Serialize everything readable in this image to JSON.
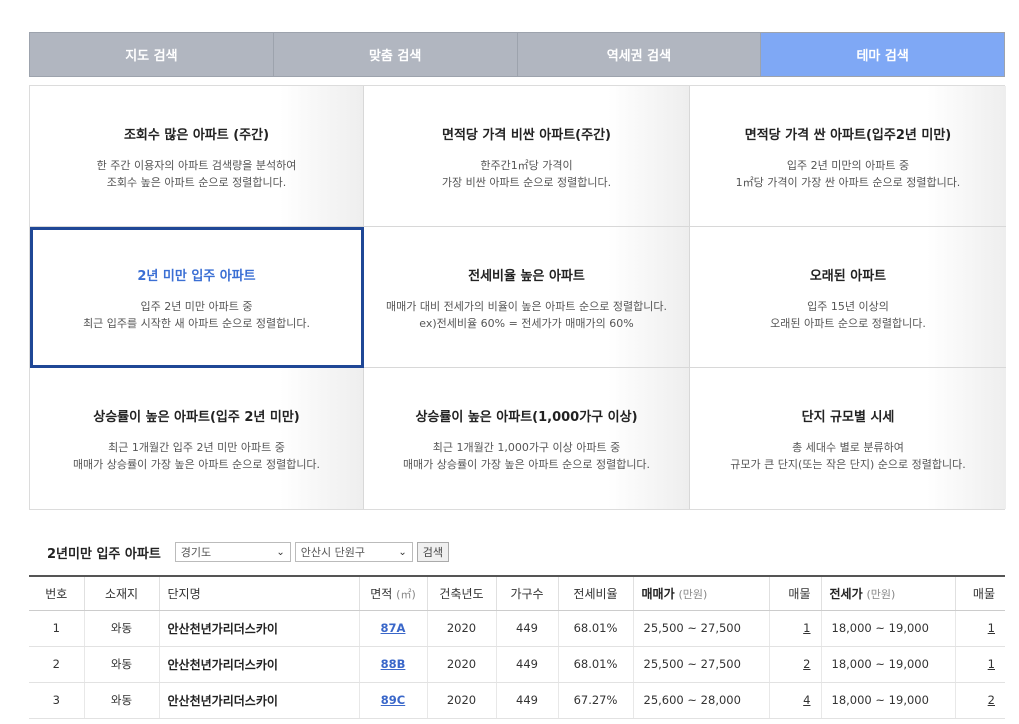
{
  "tabs": [
    {
      "label": "지도 검색"
    },
    {
      "label": "맞춤 검색"
    },
    {
      "label": "역세권 검색"
    },
    {
      "label": "테마 검색"
    }
  ],
  "themes": [
    {
      "title": "조회수 많은 아파트 (주간)",
      "desc1": "한 주간 이용자의 아파트 검색량을 분석하여",
      "desc2": "조회수 높은 아파트 순으로 정렬합니다."
    },
    {
      "title": "면적당 가격 비싼 아파트(주간)",
      "desc1": "한주간1㎡당 가격이",
      "desc2": "가장 비싼 아파트 순으로 정렬합니다."
    },
    {
      "title": "면적당 가격 싼 아파트(입주2년 미만)",
      "desc1": "입주 2년 미만의 아파트 중",
      "desc2": "1㎡당 가격이 가장 싼 아파트 순으로 정렬합니다."
    },
    {
      "title": "2년 미만 입주 아파트",
      "desc1": "입주 2년 미만 아파트 중",
      "desc2": "최근 입주를 시작한 새 아파트 순으로 정렬합니다."
    },
    {
      "title": "전세비율 높은 아파트",
      "desc1": "매매가 대비 전세가의 비율이 높은 아파트 순으로 정렬합니다.",
      "desc2": "ex)전세비율 60% = 전세가가 매매가의 60%"
    },
    {
      "title": "오래된 아파트",
      "desc1": "입주 15년 이상의",
      "desc2": "오래된 아파트 순으로 정렬합니다."
    },
    {
      "title": "상승률이 높은 아파트(입주 2년 미만)",
      "desc1": "최근 1개월간 입주 2년 미만 아파트 중",
      "desc2": "매매가 상승률이 가장 높은 아파트 순으로 정렬합니다."
    },
    {
      "title": "상승률이 높은 아파트(1,000가구 이상)",
      "desc1": "최근 1개월간 1,000가구 이상 아파트 중",
      "desc2": "매매가 상승률이 가장 높은 아파트 순으로 정렬합니다."
    },
    {
      "title": "단지 규모별 시세",
      "desc1": "총 세대수 별로 분류하여",
      "desc2": "규모가 큰 단지(또는 작은 단지) 순으로 정렬합니다."
    }
  ],
  "filter": {
    "label": "2년미만 입주 아파트",
    "province": "경기도",
    "district": "안산시 단원구",
    "search_btn": "검색"
  },
  "table": {
    "headers": {
      "no": "번호",
      "location": "소재지",
      "name": "단지명",
      "area": "면적",
      "area_unit": "(㎡)",
      "year": "건축년도",
      "households": "가구수",
      "ratio": "전세비율",
      "sale": "매매가",
      "sale_unit": "(만원)",
      "sale_cnt": "매물",
      "jeonse": "전세가",
      "jeonse_unit": "(만원)",
      "jeonse_cnt": "매물"
    },
    "rows": [
      {
        "no": "1",
        "location": "와동",
        "name": "안산천년가리더스카이",
        "area": "87A",
        "year": "2020",
        "households": "449",
        "ratio": "68.01%",
        "sale": "25,500 ~ 27,500",
        "sale_cnt": "1",
        "jeonse": "18,000 ~ 19,000",
        "jeonse_cnt": "1"
      },
      {
        "no": "2",
        "location": "와동",
        "name": "안산천년가리더스카이",
        "area": "88B",
        "year": "2020",
        "households": "449",
        "ratio": "68.01%",
        "sale": "25,500 ~ 27,500",
        "sale_cnt": "2",
        "jeonse": "18,000 ~ 19,000",
        "jeonse_cnt": "1"
      },
      {
        "no": "3",
        "location": "와동",
        "name": "안산천년가리더스카이",
        "area": "89C",
        "year": "2020",
        "households": "449",
        "ratio": "67.27%",
        "sale": "25,600 ~ 28,000",
        "sale_cnt": "4",
        "jeonse": "18,000 ~ 19,000",
        "jeonse_cnt": "2"
      }
    ]
  },
  "colors": {
    "active_tab": "#7fa8f5",
    "selected_border": "#1f4796",
    "selected_title": "#3b6fd4",
    "link": "#3a67c9"
  }
}
